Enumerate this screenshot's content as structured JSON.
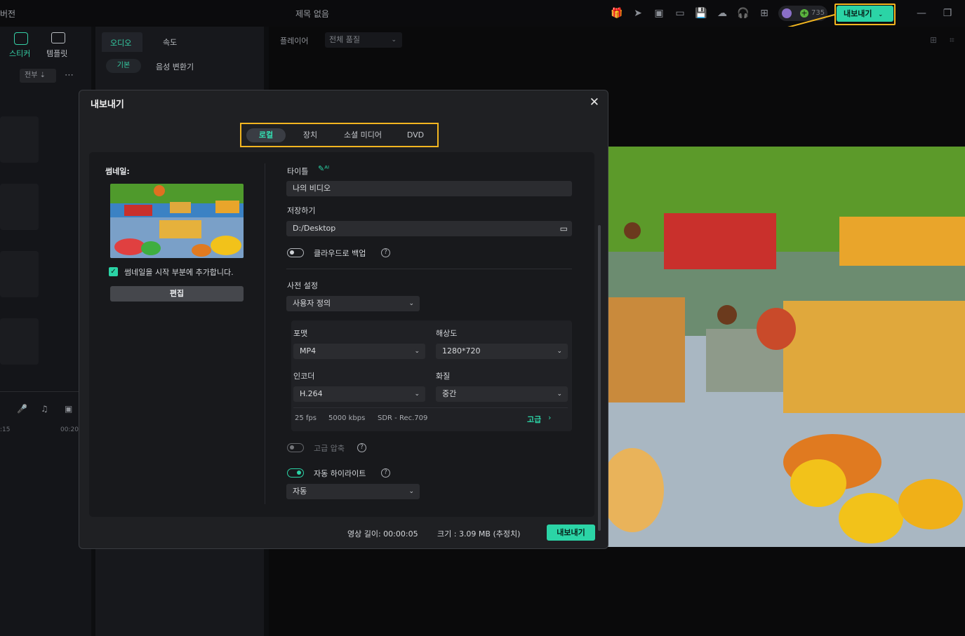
{
  "topbar": {
    "left_text": "버전",
    "title": "제목 없음",
    "credits": "735",
    "export_label": "내보내기"
  },
  "leftcol": {
    "sticker_label": "스티커",
    "template_label": "템플릿",
    "filter_label": "전부",
    "time_a": ":15",
    "time_b": "00:20"
  },
  "midcol": {
    "tab_audio": "오디오",
    "tab_speed": "속도",
    "sub_basic": "기본",
    "sub_voice": "음성 변환기"
  },
  "player": {
    "label": "플레이어",
    "quality": "전체 품질"
  },
  "dialog": {
    "title": "내보내기",
    "tabs": [
      {
        "label": "로컬",
        "active": true
      },
      {
        "label": "장치",
        "active": false
      },
      {
        "label": "소셜 미디어",
        "active": false
      },
      {
        "label": "DVD",
        "active": false
      }
    ],
    "thumbnail_label": "썸네일:",
    "thumbnail_checkbox": "썸네일을 시작 부분에 추가합니다.",
    "edit_button": "편집",
    "title_label": "타이틀",
    "title_value": "나의 비디오",
    "save_label": "저장하기",
    "save_path": "D:/Desktop",
    "cloud_backup": "클라우드로 백업",
    "preset_label": "사전 설정",
    "preset_value": "사용자 정의",
    "format_label": "포맷",
    "format_value": "MP4",
    "resolution_label": "해상도",
    "resolution_value": "1280*720",
    "encoder_label": "인코더",
    "encoder_value": "H.264",
    "quality_label": "화질",
    "quality_value": "중간",
    "fps": "25 fps",
    "bitrate": "5000 kbps",
    "color": "SDR - Rec.709",
    "advanced": "고급",
    "high_compress": "고급 압축",
    "auto_highlight": "자동 하이라이트",
    "auto_value": "자동",
    "duration": "영상 길이: 00:00:05",
    "size": "크기 :  3.09 MB (추정치)",
    "export_button": "내보내기"
  },
  "colors": {
    "accent": "#2bd4a6",
    "highlight": "#f3b620"
  }
}
